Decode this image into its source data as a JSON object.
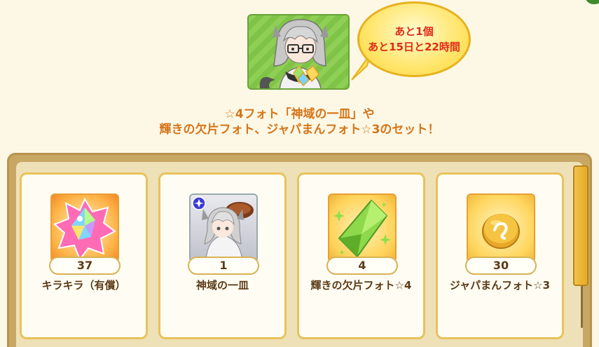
{
  "bubble": {
    "line1": "あと1個",
    "line2": "あと15日と22時間"
  },
  "headline": {
    "line1": "☆4フォト「神域の一皿」や",
    "line2": "輝きの欠片フォト、ジャパまんフォト☆3のセット！"
  },
  "items": [
    {
      "name": "キラキラ（有償）",
      "count": "37",
      "icon": "rainbow-crystal-icon"
    },
    {
      "name": "神域の一皿",
      "count": "1",
      "icon": "photo-character-icon"
    },
    {
      "name": "輝きの欠片フォト☆4",
      "count": "4",
      "icon": "green-shard-icon"
    },
    {
      "name": "ジャパまんフォト☆3",
      "count": "30",
      "icon": "japaman-bun-icon"
    }
  ],
  "colors": {
    "headline": "#d5751a",
    "bubble_text": "#e02b1a",
    "panel": "#c8a765",
    "card_border": "#e8c25a",
    "item_text": "#5b3a16"
  }
}
